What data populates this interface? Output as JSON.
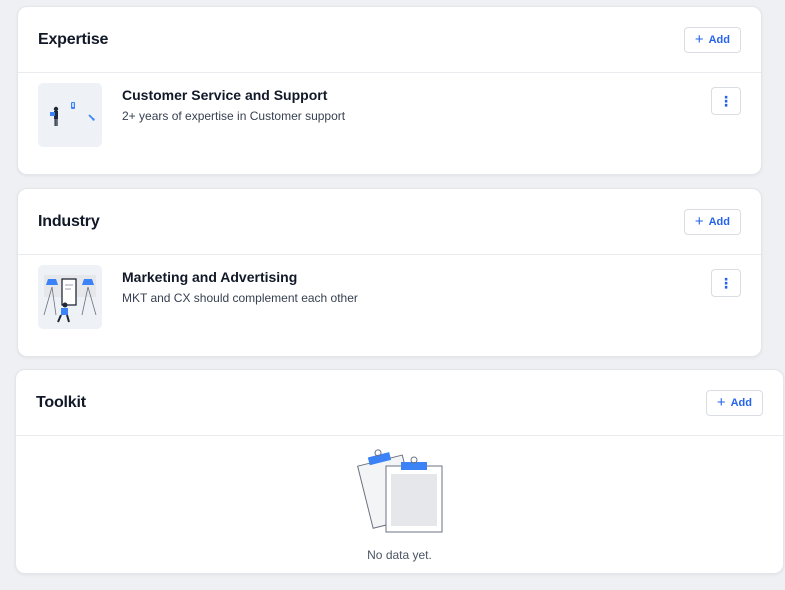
{
  "sections": {
    "expertise": {
      "title": "Expertise",
      "add_label": "Add",
      "item": {
        "title": "Customer Service and Support",
        "subtitle": "2+ years of expertise in Customer support"
      }
    },
    "industry": {
      "title": "Industry",
      "add_label": "Add",
      "item": {
        "title": "Marketing and Advertising",
        "subtitle": "MKT and CX should complement each other"
      }
    },
    "toolkit": {
      "title": "Toolkit",
      "add_label": "Add",
      "empty_text": "No data yet."
    }
  },
  "icons": {
    "add": "plus-icon",
    "more": "kebab-menu-icon"
  },
  "colors": {
    "accent": "#2563eb",
    "background": "#eef0f3",
    "card": "#ffffff"
  }
}
